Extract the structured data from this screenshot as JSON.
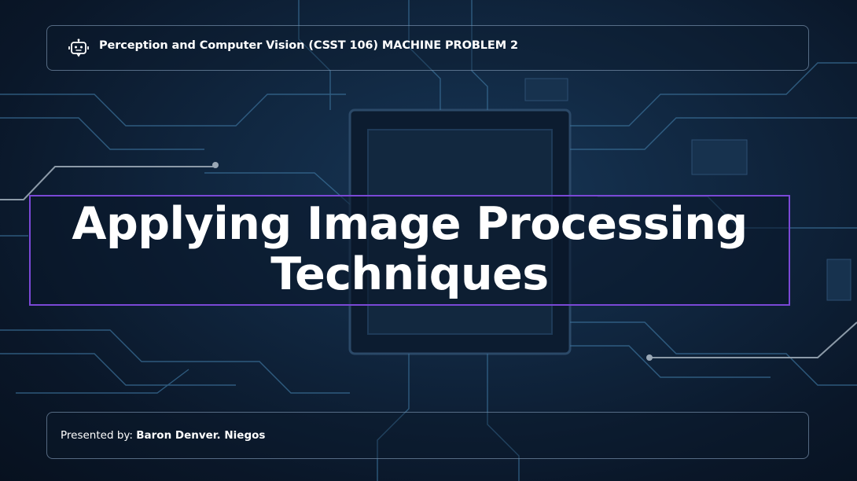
{
  "header": {
    "icon": "robot-icon",
    "title": "Perception and Computer Vision (CSST 106) MACHINE PROBLEM 2"
  },
  "main": {
    "title": "Applying Image Processing Techniques"
  },
  "footer": {
    "presented_label": "Presented by: ",
    "presenter_name": "Baron Denver. Niegos"
  },
  "colors": {
    "background": "#0b1a2e",
    "title_border": "#7a48d6",
    "text": "#ffffff"
  }
}
